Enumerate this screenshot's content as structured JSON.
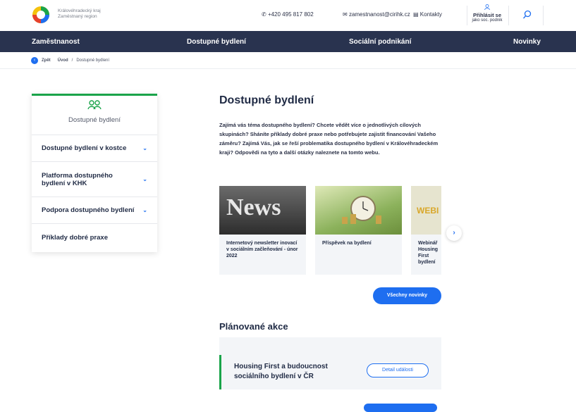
{
  "header": {
    "logo_line1": "Královéhradecký kraj",
    "logo_line2": "Zaměstnaný region",
    "phone": "+420 495 817 802",
    "email": "zamestnanost@cirihk.cz",
    "contacts": "Kontakty",
    "login_label": "Přihlásit se",
    "login_sub": "jako soc. podnik"
  },
  "nav": {
    "items": [
      "Zaměstnanost",
      "Dostupné bydlení",
      "Sociální podnikání",
      "Novinky"
    ]
  },
  "breadcrumb": {
    "back": "Zpět",
    "home": "Úvod",
    "separator": "/",
    "current": "Dostupné bydlení"
  },
  "sidebar": {
    "title": "Dostupné bydlení",
    "items": [
      {
        "label": "Dostupné bydlení v kostce"
      },
      {
        "label": "Platforma dostupného bydlení v KHK"
      },
      {
        "label": "Podpora dostupného bydlení"
      },
      {
        "label": "Příklady dobré praxe"
      }
    ]
  },
  "main": {
    "title": "Dostupné bydlení",
    "intro": "Zajímá vás téma dostupného bydlení? Chcete vědět více o jednotlivých cílových skupinách? Sháníte příklady dobré praxe nebo potřebujete zajistit financování Vašeho záměru? Zajímá Vás, jak se řeší problematika dostupného bydlení v Královéhradeckém kraji? Odpovědi na tyto a další otázky naleznete na tomto webu.",
    "news": [
      {
        "title": "Internetový newsletter inovací v sociálním začleňování - únor 2022",
        "image_text": "News"
      },
      {
        "title": "Příspěvek na bydlení"
      },
      {
        "title": "Webinář Housing First bydlení",
        "image_text": "WEBI"
      }
    ],
    "all_news_button": "Všechny novinky",
    "events_title": "Plánované akce",
    "events": [
      {
        "title": "Housing First a budoucnost sociálního bydlení v ČR",
        "button": "Detail události"
      }
    ]
  },
  "colors": {
    "navy": "#29334f",
    "green": "#1aa44a",
    "blue": "#1e6ef0"
  }
}
